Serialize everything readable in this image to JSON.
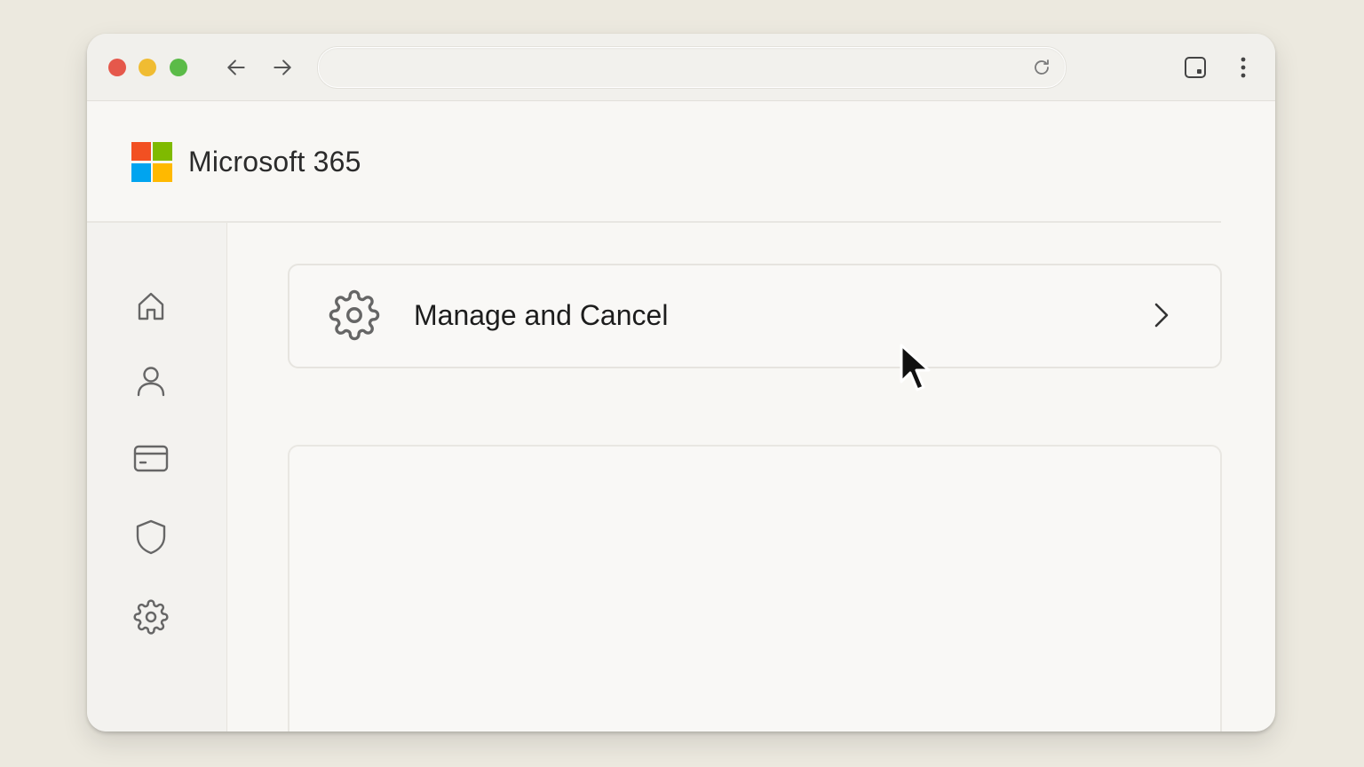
{
  "browser": {
    "address": {
      "value": "",
      "placeholder": ""
    },
    "icons": {
      "back": "arrow-left-icon",
      "forward": "arrow-right-icon",
      "reload": "reload-icon",
      "sidebar": "sidebar-toggle-icon",
      "menu": "more-vertical-icon"
    }
  },
  "app": {
    "title": "Microsoft 365",
    "logo_colors": [
      "#f25022",
      "#7fba00",
      "#00a4ef",
      "#ffb900"
    ]
  },
  "nav_rail": {
    "items": [
      {
        "icon": "home-icon"
      },
      {
        "icon": "user-icon"
      },
      {
        "icon": "credit-card-icon"
      },
      {
        "icon": "shield-icon"
      },
      {
        "icon": "gear-icon"
      }
    ]
  },
  "main": {
    "manage_card": {
      "label": "Manage and Cancel",
      "icon": "gear-icon",
      "trailing_icon": "chevron-right-icon"
    }
  }
}
